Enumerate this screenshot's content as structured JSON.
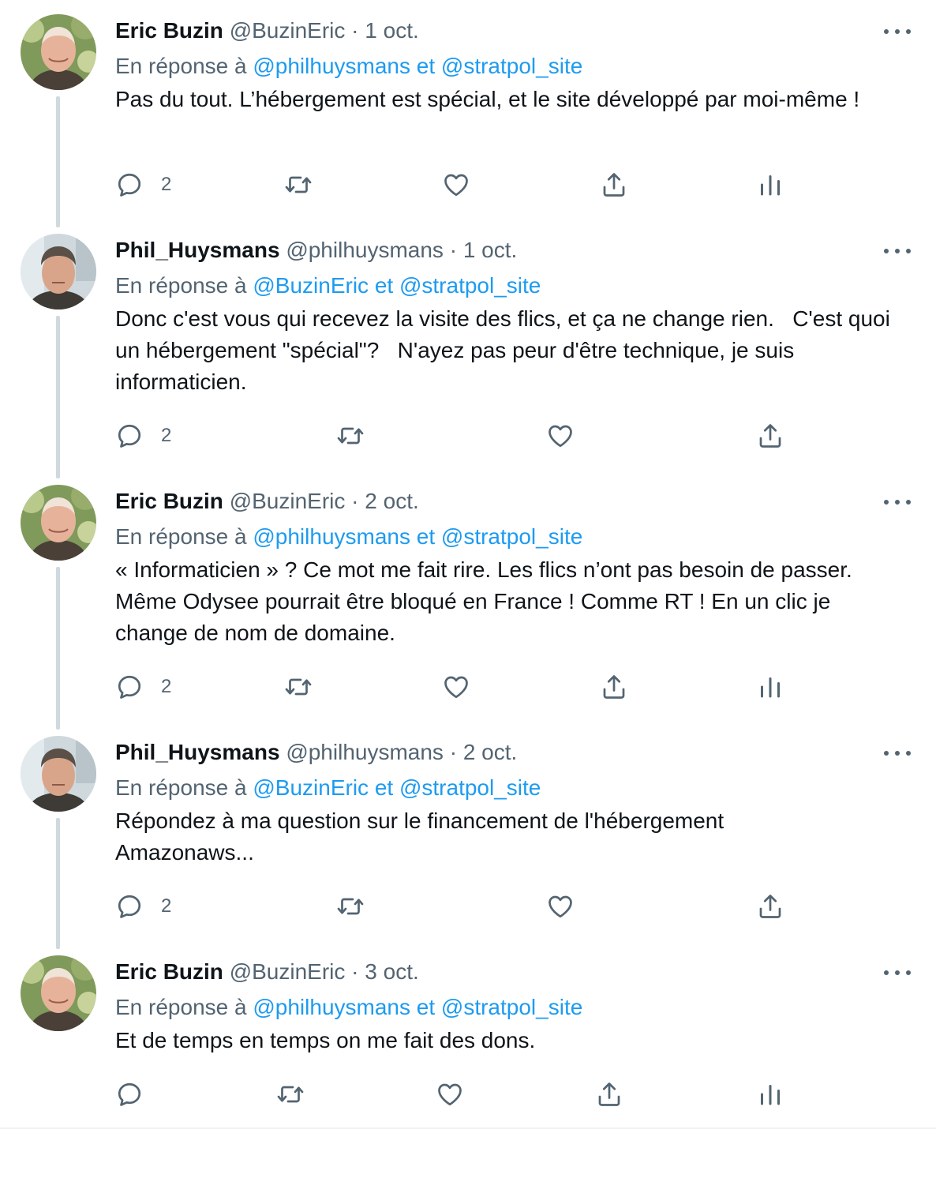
{
  "colors": {
    "text": "#0f1419",
    "muted": "#536471",
    "link": "#1d9bf0",
    "thread": "#cfd9de"
  },
  "tweets": [
    {
      "name": "Eric Buzin",
      "handle": "@BuzinEric",
      "sep": "·",
      "date": "1 oct.",
      "reply_prefix": "En réponse à",
      "reply_to_1": "@philhuysmans",
      "reply_and": "et",
      "reply_to_2": "@stratpol_site",
      "text": "Pas du tout. L’hébergement est spécial, et le site développé par moi-même !",
      "replies": "2"
    },
    {
      "name": "Phil_Huysmans",
      "handle": "@philhuysmans",
      "sep": "·",
      "date": "1 oct.",
      "reply_prefix": "En réponse à",
      "reply_to_1": "@BuzinEric",
      "reply_and": "et",
      "reply_to_2": "@stratpol_site",
      "text": "Donc c'est vous qui recevez la visite des flics, et ça ne change rien.   C'est quoi un hébergement \"spécial\"?   N'ayez pas peur d'être technique, je suis informaticien.",
      "replies": "2"
    },
    {
      "name": "Eric Buzin",
      "handle": "@BuzinEric",
      "sep": "·",
      "date": "2 oct.",
      "reply_prefix": "En réponse à",
      "reply_to_1": "@philhuysmans",
      "reply_and": "et",
      "reply_to_2": "@stratpol_site",
      "text": "« Informaticien » ? Ce mot me fait rire. Les flics n’ont pas besoin de passer. Même Odysee pourrait être bloqué en France ! Comme RT ! En un clic je change de nom de domaine.",
      "replies": "2"
    },
    {
      "name": "Phil_Huysmans",
      "handle": "@philhuysmans",
      "sep": "·",
      "date": "2 oct.",
      "reply_prefix": "En réponse à",
      "reply_to_1": "@BuzinEric",
      "reply_and": "et",
      "reply_to_2": "@stratpol_site",
      "text": "Répondez à ma question sur le financement de l'hébergement Amazonaws...",
      "replies": "2"
    },
    {
      "name": "Eric Buzin",
      "handle": "@BuzinEric",
      "sep": "·",
      "date": "3 oct.",
      "reply_prefix": "En réponse à",
      "reply_to_1": "@philhuysmans",
      "reply_and": "et",
      "reply_to_2": "@stratpol_site",
      "text": "Et de temps en temps on me fait des dons.",
      "replies": ""
    }
  ]
}
